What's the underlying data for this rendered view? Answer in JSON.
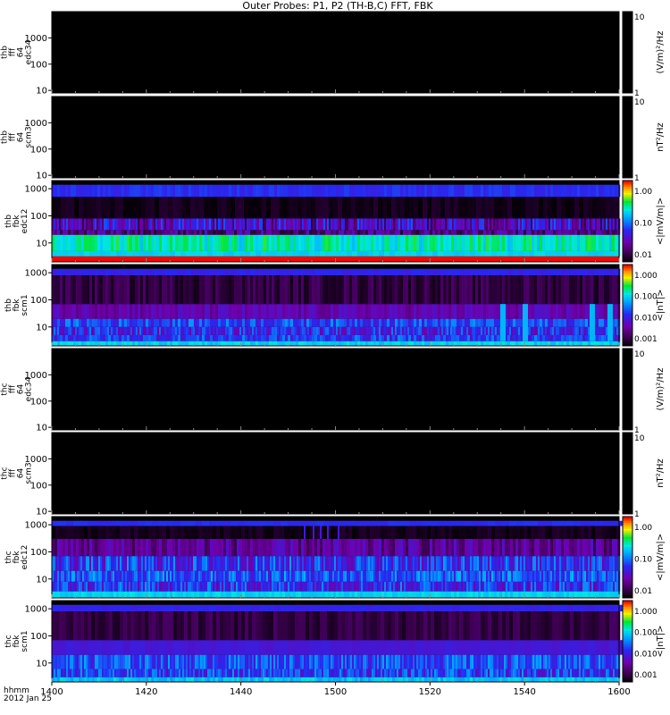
{
  "title": "Outer Probes: P1, P2 (TH-B,C) FFT, FBK",
  "chart_data": {
    "type": "heatmap",
    "title": "Outer Probes: P1, P2 (TH-B,C) FFT, FBK",
    "x_axis": {
      "label_lines": [
        "hhmm",
        "2012 Jan 25"
      ],
      "range": [
        "1400",
        "1600"
      ],
      "ticks": [
        "1400",
        "1420",
        "1440",
        "1500",
        "1520",
        "1540",
        "1600"
      ]
    },
    "panels": [
      {
        "ylabel": [
          "thb",
          "fff",
          "64",
          "edc34"
        ],
        "y_scale": "log",
        "ylim": [
          8,
          10000
        ],
        "yticks": [
          "1000",
          "100",
          "10"
        ],
        "colorbar": {
          "scale": "log",
          "labels": [
            "10",
            "1"
          ],
          "units": "(V/m)²/Hz"
        },
        "pattern": "empty"
      },
      {
        "ylabel": [
          "thb",
          "fff",
          "64",
          "scm3"
        ],
        "y_scale": "log",
        "ylim": [
          8,
          10000
        ],
        "yticks": [
          "1000",
          "100",
          "10"
        ],
        "colorbar": {
          "scale": "log",
          "labels": [
            "10",
            "1"
          ],
          "units": "nT²/Hz"
        },
        "pattern": "empty"
      },
      {
        "ylabel": [
          "thb",
          "fbk",
          "edc12"
        ],
        "y_scale": "log",
        "ylim": [
          2,
          2000
        ],
        "yticks": [
          "1000",
          "100",
          "10"
        ],
        "colorbar": {
          "scale": "log",
          "labels": [
            "1.00",
            "0.10",
            "0.01"
          ],
          "units": "<|mV/m|>"
        },
        "pattern": "fbk_e"
      },
      {
        "ylabel": [
          "thb",
          "fbk",
          "scm1"
        ],
        "y_scale": "log",
        "ylim": [
          2,
          2000
        ],
        "yticks": [
          "1000",
          "100",
          "10"
        ],
        "colorbar": {
          "scale": "log",
          "labels": [
            "1.000",
            "0.100",
            "0.010",
            "0.001"
          ],
          "units": "<|nT|>"
        },
        "pattern": "fbk_b"
      },
      {
        "ylabel": [
          "thc",
          "fff",
          "64",
          "edc34"
        ],
        "y_scale": "log",
        "ylim": [
          8,
          10000
        ],
        "yticks": [
          "1000",
          "100",
          "10"
        ],
        "colorbar": {
          "scale": "log",
          "labels": [
            "10",
            "1"
          ],
          "units": "(V/m)²/Hz"
        },
        "pattern": "empty"
      },
      {
        "ylabel": [
          "thc",
          "fff",
          "64",
          "scm3"
        ],
        "y_scale": "log",
        "ylim": [
          8,
          10000
        ],
        "yticks": [
          "1000",
          "100",
          "10"
        ],
        "colorbar": {
          "scale": "log",
          "labels": [
            "10",
            "1"
          ],
          "units": "nT²/Hz"
        },
        "pattern": "empty"
      },
      {
        "ylabel": [
          "thc",
          "fbk",
          "edc12"
        ],
        "y_scale": "log",
        "ylim": [
          2,
          2000
        ],
        "yticks": [
          "1000",
          "100",
          "10"
        ],
        "colorbar": {
          "scale": "log",
          "labels": [
            "1.00",
            "0.10",
            "0.01"
          ],
          "units": "<|mV/m|>"
        },
        "pattern": "fbk_e2"
      },
      {
        "ylabel": [
          "thc",
          "fbk",
          "scm1"
        ],
        "y_scale": "log",
        "ylim": [
          2,
          2000
        ],
        "yticks": [
          "1000",
          "100",
          "10"
        ],
        "colorbar": {
          "scale": "log",
          "labels": [
            "1.000",
            "0.100",
            "0.010",
            "0.001"
          ],
          "units": "<|nT|>"
        },
        "pattern": "fbk_b2"
      }
    ]
  }
}
